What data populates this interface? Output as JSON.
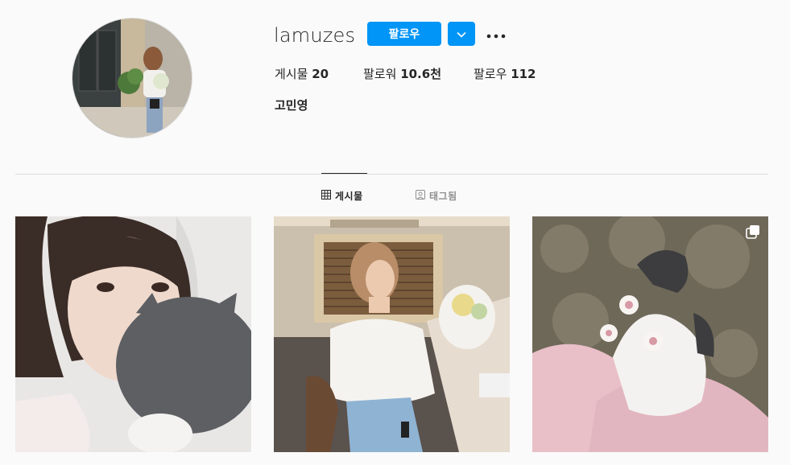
{
  "profile": {
    "username": "lamuzes",
    "full_name": "고민영",
    "follow_label": "팔로우",
    "avatar_icon": "profile-photo"
  },
  "stats": {
    "posts_label": "게시물",
    "posts_count": "20",
    "followers_label": "팔로워",
    "followers_count": "10.6천",
    "following_label": "팔로우",
    "following_count": "112"
  },
  "tabs": [
    {
      "label": "게시물",
      "icon": "grid-icon",
      "active": true
    },
    {
      "label": "태그됨",
      "icon": "tagged-icon",
      "active": false
    }
  ],
  "posts": [
    {
      "name": "post-selfie-with-cat"
    },
    {
      "name": "post-woman-with-flowers"
    },
    {
      "name": "post-cat-on-pillow",
      "multi": true
    }
  ],
  "colors": {
    "accent": "#0095f6",
    "background": "#fafafa",
    "text": "#262626",
    "muted": "#8e8e8e",
    "divider": "#dbdbdb"
  }
}
